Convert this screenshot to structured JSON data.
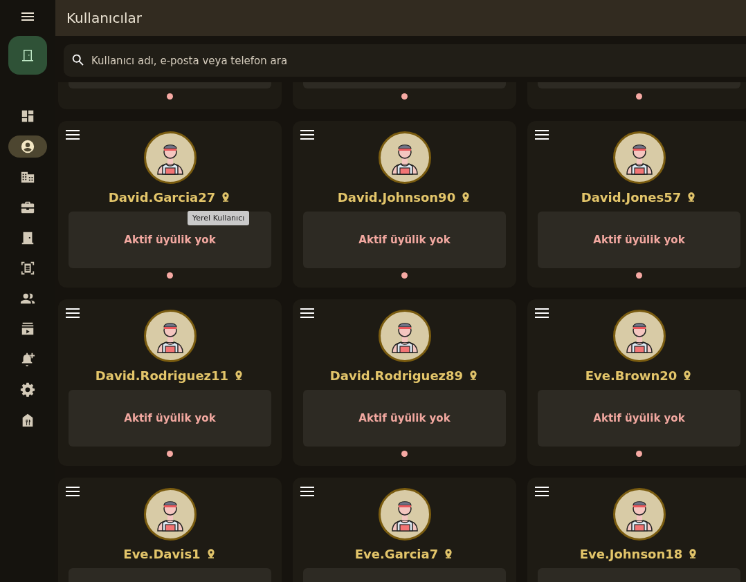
{
  "header": {
    "title": "Kullanıcılar"
  },
  "sidebar": {
    "items": [
      {
        "kind": "dashboard",
        "selected": false
      },
      {
        "kind": "account",
        "selected": true
      },
      {
        "kind": "building",
        "selected": false
      },
      {
        "kind": "briefcase",
        "selected": false
      },
      {
        "kind": "door",
        "selected": false
      },
      {
        "kind": "list",
        "selected": false
      },
      {
        "kind": "group",
        "selected": false
      },
      {
        "kind": "video",
        "selected": false
      },
      {
        "kind": "bell",
        "selected": false
      },
      {
        "kind": "gear",
        "selected": false
      },
      {
        "kind": "restaurant",
        "selected": false
      }
    ]
  },
  "search": {
    "placeholder": "Kullanıcı adı, e-posta veya telefon ara"
  },
  "cards": [
    {
      "kind": "clipped"
    },
    {
      "kind": "clipped"
    },
    {
      "kind": "clipped"
    },
    {
      "kind": "full",
      "name": "David.Garcia27",
      "status": "Aktif üyülik yok",
      "tooltip": "Yerel Kullanıcı"
    },
    {
      "kind": "full",
      "name": "David.Johnson90",
      "status": "Aktif üyülik yok"
    },
    {
      "kind": "full",
      "name": "David.Jones57",
      "status": "Aktif üyülik yok"
    },
    {
      "kind": "full",
      "name": "David.Rodriguez11",
      "status": "Aktif üyülik yok"
    },
    {
      "kind": "full",
      "name": "David.Rodriguez89",
      "status": "Aktif üyülik yok"
    },
    {
      "kind": "full",
      "name": "Eve.Brown20",
      "status": "Aktif üyülik yok"
    },
    {
      "kind": "full",
      "name": "Eve.Davis1"
    },
    {
      "kind": "full",
      "name": "Eve.Garcia7"
    },
    {
      "kind": "full",
      "name": "Eve.Johnson18"
    }
  ]
}
